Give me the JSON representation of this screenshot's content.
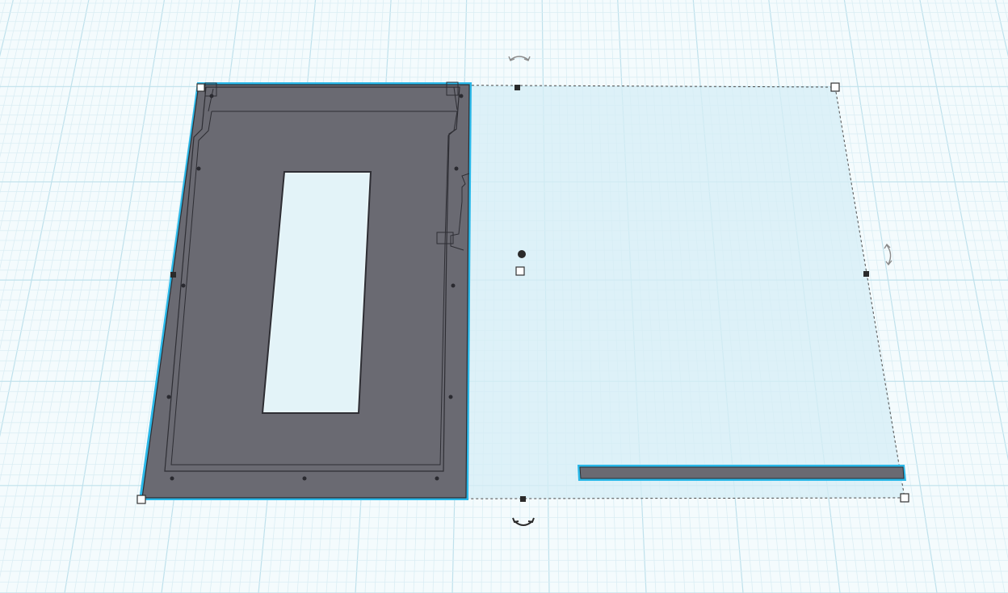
{
  "scene": {
    "workplane": "grid",
    "selection": {
      "objects": [
        {
          "name": "frame-plate",
          "role": "solid",
          "color": "#6a6a72",
          "outline_color": "#2bb8e8"
        },
        {
          "name": "thin-bar",
          "role": "solid",
          "color": "#6a6a72",
          "outline_color": "#2bb8e8"
        }
      ],
      "bounding_box_fill": "#d6edf5",
      "handles": [
        "corner-handle-top-left",
        "corner-handle-top-right",
        "corner-handle-bottom-left",
        "corner-handle-bottom-right",
        "edge-handle-top",
        "edge-handle-bottom",
        "edge-handle-left",
        "edge-handle-right",
        "height-handle",
        "elevation-handle"
      ],
      "rotation_icons": [
        "rotate-top-icon",
        "rotate-right-icon",
        "rotate-bottom-icon"
      ]
    },
    "colors": {
      "grid_minor": "#dbeef4",
      "grid_major": "#bfe1ec",
      "background": "#f4fbfd",
      "solid": "#6a6a72",
      "solid_dark": "#3a3a40",
      "highlight": "#2bb8e8"
    }
  }
}
